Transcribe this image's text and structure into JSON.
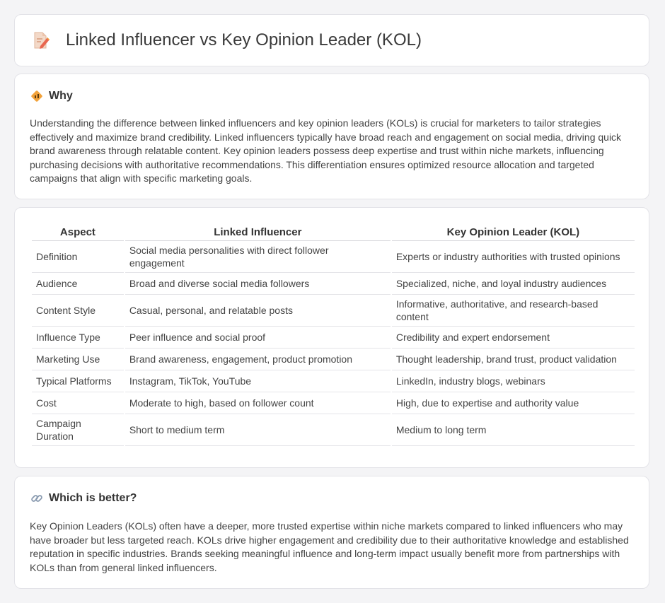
{
  "header": {
    "title": "Linked Influencer vs Key Opinion Leader (KOL)",
    "icon": "document-pencil-icon"
  },
  "why": {
    "icon": "diamond-sign-icon",
    "title": "Why",
    "body": "Understanding the difference between linked influencers and key opinion leaders (KOLs) is crucial for marketers to tailor strategies effectively and maximize brand credibility. Linked influencers typically have broad reach and engagement on social media, driving quick brand awareness through relatable content. Key opinion leaders possess deep expertise and trust within niche markets, influencing purchasing decisions with authoritative recommendations. This differentiation ensures optimized resource allocation and targeted campaigns that align with specific marketing goals."
  },
  "table": {
    "headers": [
      "Aspect",
      "Linked Influencer",
      "Key Opinion Leader (KOL)"
    ],
    "rows": [
      [
        "Definition",
        "Social media personalities with direct follower engagement",
        "Experts or industry authorities with trusted opinions"
      ],
      [
        "Audience",
        "Broad and diverse social media followers",
        "Specialized, niche, and loyal industry audiences"
      ],
      [
        "Content Style",
        "Casual, personal, and relatable posts",
        "Informative, authoritative, and research-based content"
      ],
      [
        "Influence Type",
        "Peer influence and social proof",
        "Credibility and expert endorsement"
      ],
      [
        "Marketing Use",
        "Brand awareness, engagement, product promotion",
        "Thought leadership, brand trust, product validation"
      ],
      [
        "Typical Platforms",
        "Instagram, TikTok, YouTube",
        "LinkedIn, industry blogs, webinars"
      ],
      [
        "Cost",
        "Moderate to high, based on follower count",
        "High, due to expertise and authority value"
      ],
      [
        "Campaign Duration",
        "Short to medium term",
        "Medium to long term"
      ]
    ]
  },
  "better": {
    "icon": "link-icon",
    "title": "Which is better?",
    "body": "Key Opinion Leaders (KOLs) often have a deeper, more trusted expertise within niche markets compared to linked influencers who may have broader but less targeted reach. KOLs drive higher engagement and credibility due to their authoritative knowledge and established reputation in specific industries. Brands seeking meaningful influence and long-term impact usually benefit more from partnerships with KOLs than from general linked influencers."
  },
  "colors": {
    "background": "#f4f4f6",
    "card": "#ffffff",
    "accent_orange": "#f0a030",
    "icon_pink": "#e87c6a"
  }
}
